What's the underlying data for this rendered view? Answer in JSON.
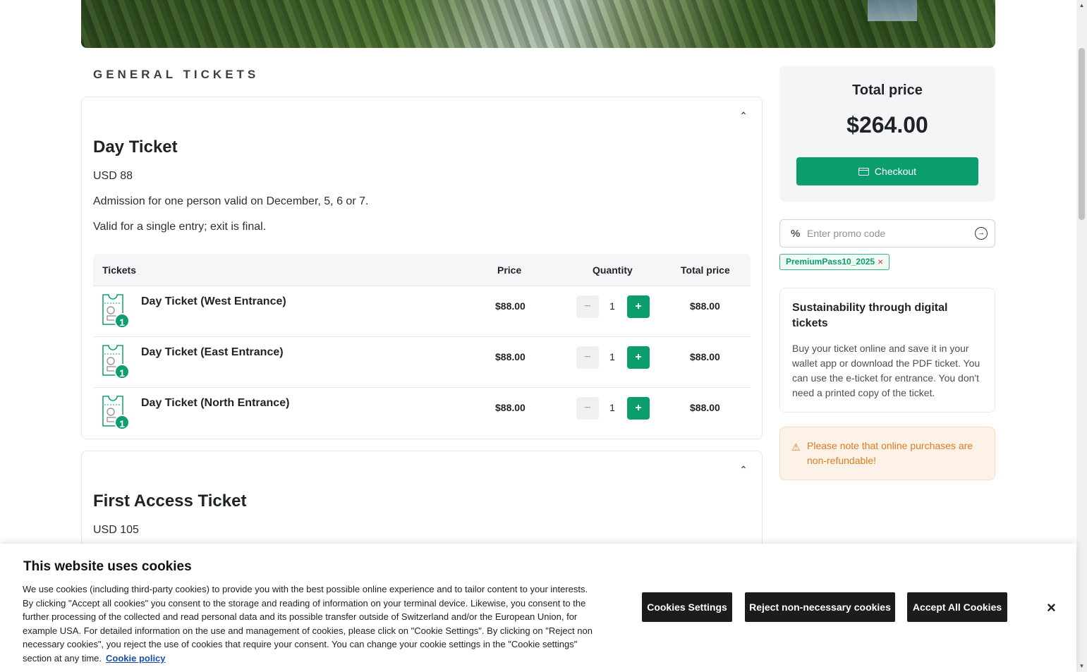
{
  "section_title": "GENERAL TICKETS",
  "cards": [
    {
      "title": "Day Ticket",
      "price": "USD 88",
      "desc1": "Admission for one person valid on December, 5, 6 or 7.",
      "desc2": "Valid for a single entry; exit is final.",
      "table": {
        "headers": {
          "tickets": "Tickets",
          "price": "Price",
          "quantity": "Quantity",
          "total": "Total price"
        },
        "rows": [
          {
            "name": "Day Ticket (West Entrance)",
            "badge": "1",
            "price": "$88.00",
            "qty": "1",
            "total": "$88.00"
          },
          {
            "name": "Day Ticket (East Entrance)",
            "badge": "1",
            "price": "$88.00",
            "qty": "1",
            "total": "$88.00"
          },
          {
            "name": "Day Ticket (North Entrance)",
            "badge": "1",
            "price": "$88.00",
            "qty": "1",
            "total": "$88.00"
          }
        ]
      }
    },
    {
      "title": "First Access Ticket",
      "price": "USD 105"
    }
  ],
  "qty_buttons": {
    "minus": "−",
    "plus": "+"
  },
  "collapse_glyph": "⌃",
  "sidebar": {
    "total_label": "Total price",
    "total_value": "$264.00",
    "checkout_label": "Checkout",
    "promo_icon": "%",
    "promo_placeholder": "Enter promo code",
    "promo_go": "→",
    "promo_tag": "PremiumPass10_2025",
    "promo_tag_remove": "×",
    "sustain_title": "Sustainability through digital tickets",
    "sustain_text": "Buy your ticket online and save it in your wallet app or download the PDF ticket. You can use the e-ticket for entrance. You don't need a printed copy of the ticket.",
    "notice_icon": "⚠",
    "notice_text": "Please note that online purchases are non-refundable!"
  },
  "cookie": {
    "title": "This website uses cookies",
    "text": "We use cookies (including third-party cookies) to provide you with the best possible online experience and to tailor content to your interests. By clicking \"Accept all cookies\" you consent to the storage and reading of information on your terminal device. Likewise, you consent to the further processing of the collected and read personal data and its possible transfer outside of Switzerland and/or the European Union, for example USA. For detailed information on the use and management of cookies, please click on \"Cookie Settings\". By clicking on \"Reject non necessary cookies\", you reject the use of cookies that require your consent. You can change your cookie settings in the \"Cookie settings\" section at any time.",
    "link": "Cookie policy",
    "settings_btn": "Cookies Settings",
    "reject_btn": "Reject non-necessary cookies",
    "accept_btn": "Accept All Cookies",
    "close": "×"
  },
  "scrollbar": {
    "up": "▲",
    "down": "▼"
  },
  "colors": {
    "accent": "#0b9d6e",
    "warning": "#e07a1f",
    "cookie_button": "#1c1c1c"
  },
  "icons": {
    "ticket": "ticket-icon",
    "checkout": "credit-card-icon",
    "warning": "warning-icon"
  }
}
